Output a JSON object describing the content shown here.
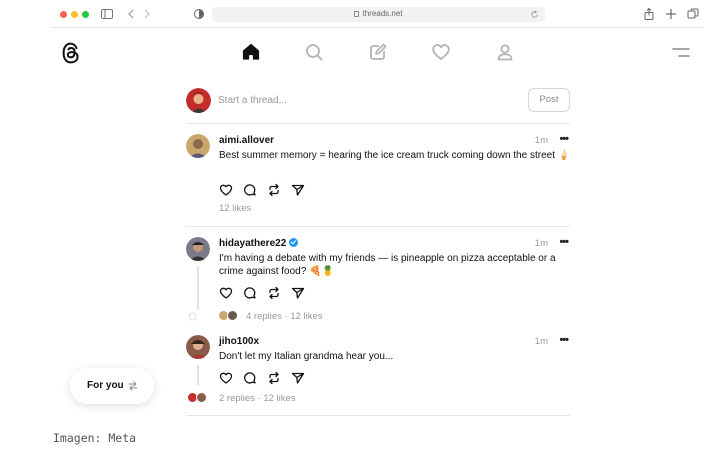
{
  "browser": {
    "url": "threads.net"
  },
  "nav": {
    "icons": [
      "threads-logo",
      "home-icon",
      "search-icon",
      "compose-icon",
      "heart-icon",
      "profile-icon",
      "menu-icon"
    ]
  },
  "composer": {
    "placeholder": "Start a thread...",
    "post_label": "Post"
  },
  "posts": [
    {
      "user": "aimi.allover",
      "verified": false,
      "time": "1m",
      "text": "Best summer memory = hearing the ice cream truck coming down the street 🍦",
      "stats": "12 likes"
    },
    {
      "user": "hidayathere22",
      "verified": true,
      "time": "1m",
      "text": "I'm having a debate with my friends — is pineapple on pizza acceptable or a crime against food? 🍕🍍",
      "stats": "4 replies · 12 likes"
    },
    {
      "user": "jiho100x",
      "verified": false,
      "time": "1m",
      "text": "Don't let my Italian grandma hear you...",
      "stats": "2 replies · 12 likes"
    }
  ],
  "foryou": {
    "label": "For you"
  },
  "caption": "Imagen: Meta",
  "colors": {
    "accent_verified": "#1d9bf0",
    "text_primary": "#111111",
    "text_muted": "#999999"
  }
}
